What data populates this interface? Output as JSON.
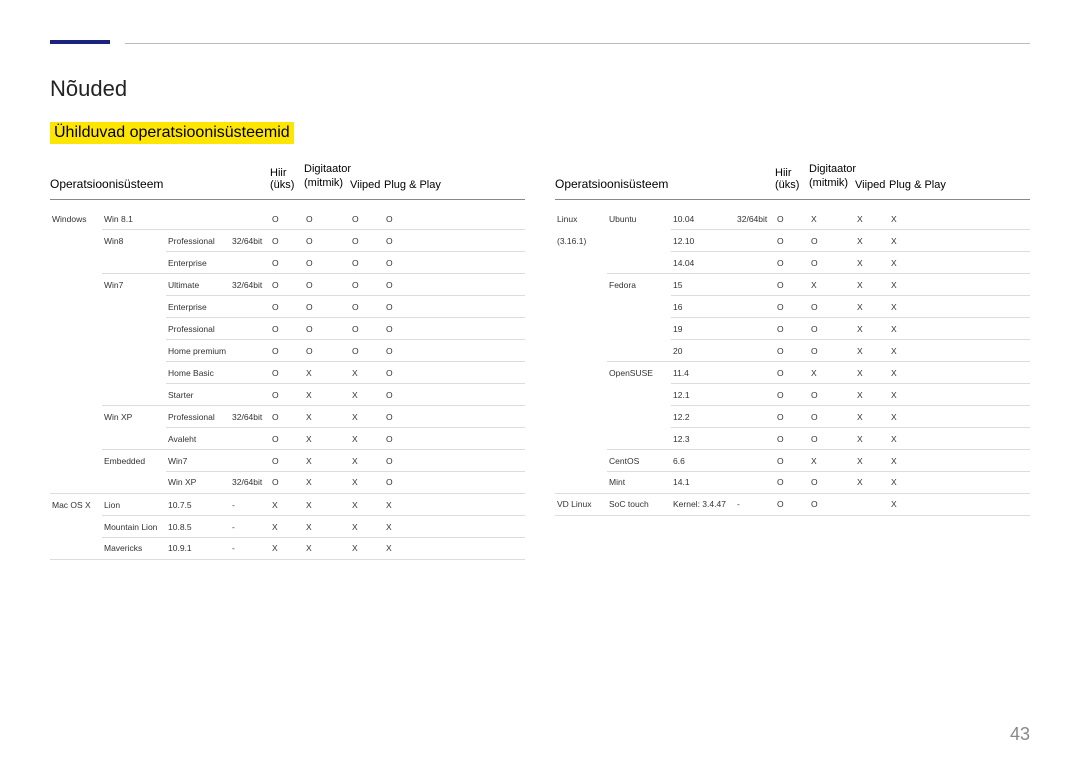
{
  "page_title": "Nõuded",
  "section_title": "Ühilduvad operatsioonisüsteemid",
  "page_number": "43",
  "headers": {
    "os": "Operatsioonisüsteem",
    "mouse": "Hiir (üks)",
    "digitizer": "Digitaator\n(mitmik)",
    "gesture": "Viiped",
    "plug": "Plug & Play"
  },
  "left_rows": [
    {
      "c": [
        "Windows",
        "Win 8.1",
        "",
        "",
        "O",
        "O",
        "O",
        "O"
      ],
      "b": 2
    },
    {
      "c": [
        "",
        "Win8",
        "Professional",
        "32/64bit",
        "O",
        "O",
        "O",
        "O"
      ],
      "b": 3
    },
    {
      "c": [
        "",
        "",
        "Enterprise",
        "",
        "O",
        "O",
        "O",
        "O"
      ],
      "b": 2
    },
    {
      "c": [
        "",
        "Win7",
        "Ultimate",
        "32/64bit",
        "O",
        "O",
        "O",
        "O"
      ],
      "b": 3
    },
    {
      "c": [
        "",
        "",
        "Enterprise",
        "",
        "O",
        "O",
        "O",
        "O"
      ],
      "b": 3
    },
    {
      "c": [
        "",
        "",
        "Professional",
        "",
        "O",
        "O",
        "O",
        "O"
      ],
      "b": 3
    },
    {
      "c": [
        "",
        "",
        "Home premium",
        "",
        "O",
        "O",
        "O",
        "O"
      ],
      "b": 3
    },
    {
      "c": [
        "",
        "",
        "Home Basic",
        "",
        "O",
        "X",
        "X",
        "O"
      ],
      "b": 3
    },
    {
      "c": [
        "",
        "",
        "Starter",
        "",
        "O",
        "X",
        "X",
        "O"
      ],
      "b": 2
    },
    {
      "c": [
        "",
        "Win XP",
        "Professional",
        "32/64bit",
        "O",
        "X",
        "X",
        "O"
      ],
      "b": 3
    },
    {
      "c": [
        "",
        "",
        "Avaleht",
        "",
        "O",
        "X",
        "X",
        "O"
      ],
      "b": 2
    },
    {
      "c": [
        "",
        "Embedded",
        "Win7",
        "",
        "O",
        "X",
        "X",
        "O"
      ],
      "b": 3
    },
    {
      "c": [
        "",
        "",
        "Win XP",
        "32/64bit",
        "O",
        "X",
        "X",
        "O"
      ],
      "b": 1
    },
    {
      "c": [
        "Mac OS X",
        "Lion",
        "10.7.5",
        "-",
        "X",
        "X",
        "X",
        "X"
      ],
      "b": 2
    },
    {
      "c": [
        "",
        "Mountain Lion",
        "10.8.5",
        "-",
        "X",
        "X",
        "X",
        "X"
      ],
      "b": 2
    },
    {
      "c": [
        "",
        "Mavericks",
        "10.9.1",
        "-",
        "X",
        "X",
        "X",
        "X"
      ],
      "b": 1
    }
  ],
  "right_rows": [
    {
      "c": [
        "Linux",
        "Ubuntu",
        "10.04",
        "32/64bit",
        "O",
        "X",
        "X",
        "X"
      ],
      "b": 3
    },
    {
      "c": [
        "(3.16.1)",
        "",
        "12.10",
        "",
        "O",
        "O",
        "X",
        "X"
      ],
      "b": 3
    },
    {
      "c": [
        "",
        "",
        "14.04",
        "",
        "O",
        "O",
        "X",
        "X"
      ],
      "b": 2
    },
    {
      "c": [
        "",
        "Fedora",
        "15",
        "",
        "O",
        "X",
        "X",
        "X"
      ],
      "b": 3
    },
    {
      "c": [
        "",
        "",
        "16",
        "",
        "O",
        "O",
        "X",
        "X"
      ],
      "b": 3
    },
    {
      "c": [
        "",
        "",
        "19",
        "",
        "O",
        "O",
        "X",
        "X"
      ],
      "b": 3
    },
    {
      "c": [
        "",
        "",
        "20",
        "",
        "O",
        "O",
        "X",
        "X"
      ],
      "b": 2
    },
    {
      "c": [
        "",
        "OpenSUSE",
        "11.4",
        "",
        "O",
        "X",
        "X",
        "X"
      ],
      "b": 3
    },
    {
      "c": [
        "",
        "",
        "12.1",
        "",
        "O",
        "O",
        "X",
        "X"
      ],
      "b": 3
    },
    {
      "c": [
        "",
        "",
        "12.2",
        "",
        "O",
        "O",
        "X",
        "X"
      ],
      "b": 3
    },
    {
      "c": [
        "",
        "",
        "12.3",
        "",
        "O",
        "O",
        "X",
        "X"
      ],
      "b": 2
    },
    {
      "c": [
        "",
        "CentOS",
        "6.6",
        "",
        "O",
        "X",
        "X",
        "X"
      ],
      "b": 2
    },
    {
      "c": [
        "",
        "Mint",
        "14.1",
        "",
        "O",
        "O",
        "X",
        "X"
      ],
      "b": 1
    },
    {
      "c": [
        "VD Linux",
        "SoC touch",
        "Kernel: 3.4.47",
        "-",
        "O",
        "O",
        "",
        "X"
      ],
      "b": 1
    }
  ]
}
